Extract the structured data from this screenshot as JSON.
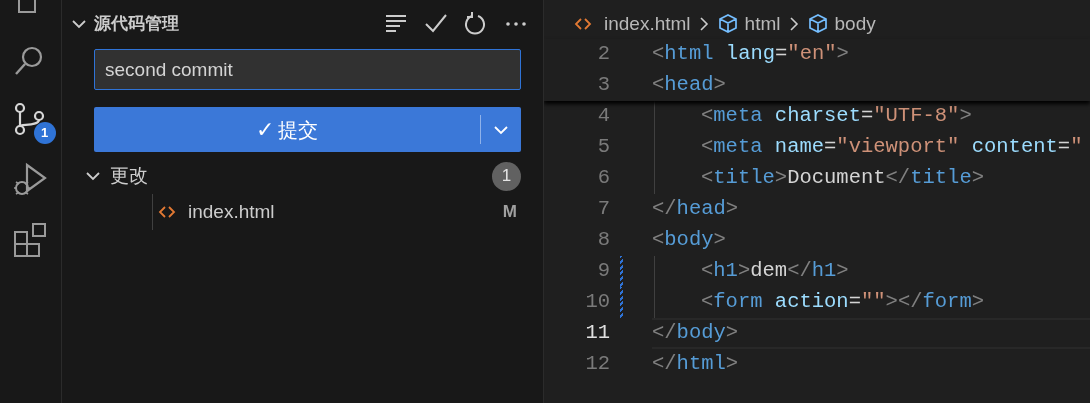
{
  "activity_bar": {
    "items": [
      {
        "kind": "files",
        "selected": false
      },
      {
        "kind": "search",
        "selected": false
      },
      {
        "kind": "source-control",
        "selected": true,
        "badge": "1"
      },
      {
        "kind": "run",
        "selected": false
      },
      {
        "kind": "extensions",
        "selected": false
      }
    ]
  },
  "sidebar": {
    "title": "源代码管理",
    "expanded": true,
    "commit_message": {
      "value": "second commit"
    },
    "commit_button": {
      "icon": "✓",
      "label": "提交"
    },
    "changes": {
      "label": "更改",
      "expanded": true,
      "count": "1",
      "files": [
        {
          "name": "index.html",
          "status": "M"
        }
      ]
    }
  },
  "editor": {
    "breadcrumbs": [
      {
        "kind": "file",
        "label": "index.html"
      },
      {
        "kind": "element",
        "label": "html"
      },
      {
        "kind": "element",
        "label": "body"
      }
    ],
    "sticky_lines": [
      {
        "number": "2",
        "indented": false,
        "modified": false,
        "current": false,
        "tokens": [
          {
            "kind": "bracket",
            "text": "<"
          },
          {
            "kind": "tag",
            "text": "html"
          },
          {
            "kind": "attr",
            "text": " lang"
          },
          {
            "kind": "text",
            "text": "="
          },
          {
            "kind": "string",
            "text": "\"en\""
          },
          {
            "kind": "bracket",
            "text": ">"
          }
        ]
      },
      {
        "number": "3",
        "indented": false,
        "modified": false,
        "current": false,
        "tokens": [
          {
            "kind": "bracket",
            "text": "<"
          },
          {
            "kind": "tag",
            "text": "head"
          },
          {
            "kind": "bracket",
            "text": ">"
          }
        ]
      }
    ],
    "lines": [
      {
        "number": "4",
        "indented": true,
        "modified": false,
        "current": false,
        "tokens": [
          {
            "kind": "bracket",
            "text": "<"
          },
          {
            "kind": "tag",
            "text": "meta"
          },
          {
            "kind": "attr",
            "text": " charset"
          },
          {
            "kind": "text",
            "text": "="
          },
          {
            "kind": "string",
            "text": "\"UTF-8\""
          },
          {
            "kind": "bracket",
            "text": ">"
          }
        ]
      },
      {
        "number": "5",
        "indented": true,
        "modified": false,
        "current": false,
        "tokens": [
          {
            "kind": "bracket",
            "text": "<"
          },
          {
            "kind": "tag",
            "text": "meta"
          },
          {
            "kind": "attr",
            "text": " name"
          },
          {
            "kind": "text",
            "text": "="
          },
          {
            "kind": "string",
            "text": "\"viewport\""
          },
          {
            "kind": "attr",
            "text": " content"
          },
          {
            "kind": "text",
            "text": "="
          },
          {
            "kind": "string",
            "text": "\""
          }
        ]
      },
      {
        "number": "6",
        "indented": true,
        "modified": false,
        "current": false,
        "tokens": [
          {
            "kind": "bracket",
            "text": "<"
          },
          {
            "kind": "tag",
            "text": "title"
          },
          {
            "kind": "bracket",
            "text": ">"
          },
          {
            "kind": "text",
            "text": "Document"
          },
          {
            "kind": "bracket",
            "text": "</"
          },
          {
            "kind": "tag",
            "text": "title"
          },
          {
            "kind": "bracket",
            "text": ">"
          }
        ]
      },
      {
        "number": "7",
        "indented": false,
        "modified": false,
        "current": false,
        "tokens": [
          {
            "kind": "bracket",
            "text": "</"
          },
          {
            "kind": "tag",
            "text": "head"
          },
          {
            "kind": "bracket",
            "text": ">"
          }
        ]
      },
      {
        "number": "8",
        "indented": false,
        "modified": false,
        "current": false,
        "tokens": [
          {
            "kind": "bracket",
            "text": "<"
          },
          {
            "kind": "tag",
            "text": "body"
          },
          {
            "kind": "bracket",
            "text": ">"
          }
        ]
      },
      {
        "number": "9",
        "indented": true,
        "modified": true,
        "current": false,
        "tokens": [
          {
            "kind": "bracket",
            "text": "<"
          },
          {
            "kind": "tag",
            "text": "h1"
          },
          {
            "kind": "bracket",
            "text": ">"
          },
          {
            "kind": "text",
            "text": "dem"
          },
          {
            "kind": "bracket",
            "text": "</"
          },
          {
            "kind": "tag",
            "text": "h1"
          },
          {
            "kind": "bracket",
            "text": ">"
          }
        ]
      },
      {
        "number": "10",
        "indented": true,
        "modified": true,
        "current": false,
        "tokens": [
          {
            "kind": "bracket",
            "text": "<"
          },
          {
            "kind": "tag",
            "text": "form"
          },
          {
            "kind": "attr",
            "text": " action"
          },
          {
            "kind": "text",
            "text": "="
          },
          {
            "kind": "string",
            "text": "\"\""
          },
          {
            "kind": "bracket",
            "text": "></"
          },
          {
            "kind": "tag",
            "text": "form"
          },
          {
            "kind": "bracket",
            "text": ">"
          }
        ]
      },
      {
        "number": "11",
        "indented": false,
        "modified": false,
        "current": true,
        "tokens": [
          {
            "kind": "bracket",
            "text": "</"
          },
          {
            "kind": "tag",
            "text": "body"
          },
          {
            "kind": "bracket",
            "text": ">"
          }
        ]
      },
      {
        "number": "12",
        "indented": false,
        "modified": false,
        "current": false,
        "tokens": [
          {
            "kind": "bracket",
            "text": "</"
          },
          {
            "kind": "tag",
            "text": "html"
          },
          {
            "kind": "bracket",
            "text": ">"
          }
        ]
      }
    ]
  }
}
